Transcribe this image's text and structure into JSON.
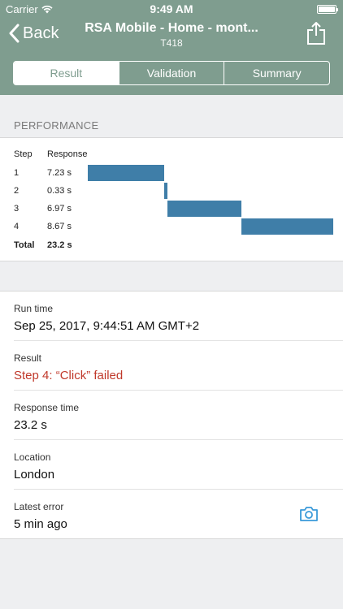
{
  "status_bar": {
    "carrier": "Carrier",
    "time": "9:49 AM"
  },
  "nav": {
    "back_label": "Back",
    "title": "RSA Mobile - Home - mont...",
    "subtitle": "T418"
  },
  "tabs": [
    {
      "label": "Result",
      "active": true
    },
    {
      "label": "Validation",
      "active": false
    },
    {
      "label": "Summary",
      "active": false
    }
  ],
  "performance": {
    "section_label": "PERFORMANCE",
    "col_step": "Step",
    "col_response": "Response",
    "rows": [
      {
        "step": "1",
        "response": "7.23 s",
        "seconds": 7.23
      },
      {
        "step": "2",
        "response": "0.33 s",
        "seconds": 0.33
      },
      {
        "step": "3",
        "response": "6.97 s",
        "seconds": 6.97
      },
      {
        "step": "4",
        "response": "8.67 s",
        "seconds": 8.67
      }
    ],
    "total_label": "Total",
    "total_value": "23.2 s",
    "bar_color": "#3f7ea8"
  },
  "details": {
    "run_time_label": "Run time",
    "run_time_value": "Sep 25, 2017, 9:44:51 AM GMT+2",
    "result_label": "Result",
    "result_value": "Step 4: “Click” failed",
    "response_time_label": "Response time",
    "response_time_value": "23.2 s",
    "location_label": "Location",
    "location_value": "London",
    "latest_error_label": "Latest error",
    "latest_error_value": "5 min ago"
  },
  "icons": {
    "back": "chevron-left-icon",
    "share": "share-icon",
    "camera": "camera-icon",
    "wifi": "wifi-icon",
    "battery": "battery-icon"
  },
  "colors": {
    "header": "#7f9d8f",
    "error": "#c0392b",
    "camera": "#3a9ad9"
  }
}
